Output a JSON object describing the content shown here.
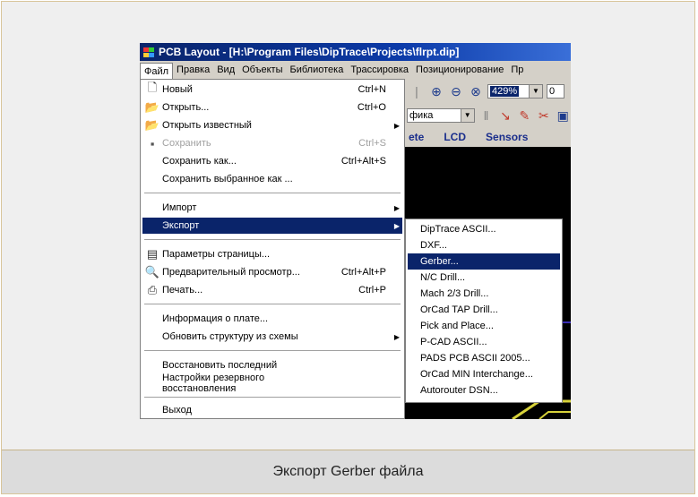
{
  "caption": "Экспорт Gerber файла",
  "window": {
    "title": "PCB Layout - [H:\\Program Files\\DipTrace\\Projects\\flrpt.dip]"
  },
  "menubar": [
    "Файл",
    "Правка",
    "Вид",
    "Объекты",
    "Библиотека",
    "Трассировка",
    "Позиционирование",
    "Пр"
  ],
  "toolbar": {
    "zoom_value": "429%",
    "combo2_value": "фика",
    "trailing_value": "0"
  },
  "tabs": [
    "ete",
    "LCD",
    "Sensors"
  ],
  "file_menu": {
    "items": [
      {
        "icon": "new-doc-icon",
        "label": "Новый",
        "shortcut": "Ctrl+N"
      },
      {
        "icon": "open-folder-icon",
        "label": "Открыть...",
        "shortcut": "Ctrl+O"
      },
      {
        "icon": "open-folder-icon",
        "label": "Открыть известный",
        "submenu": true
      },
      {
        "icon": "save-icon",
        "label": "Сохранить",
        "shortcut": "Ctrl+S",
        "disabled": true
      },
      {
        "label": "Сохранить как...",
        "shortcut": "Ctrl+Alt+S"
      },
      {
        "label": "Сохранить выбранное как ..."
      },
      {
        "label": "Импорт",
        "submenu": true
      },
      {
        "label": "Экспорт",
        "submenu": true,
        "highlighted": true
      },
      {
        "icon": "page-setup-icon",
        "label": "Параметры страницы..."
      },
      {
        "icon": "preview-icon",
        "label": "Предварительный просмотр...",
        "shortcut": "Ctrl+Alt+P"
      },
      {
        "icon": "printer-icon",
        "label": "Печать...",
        "shortcut": "Ctrl+P"
      },
      {
        "label": "Информация о плате..."
      },
      {
        "label": "Обновить структуру из схемы",
        "submenu": true
      },
      {
        "label": "Восстановить последний"
      },
      {
        "label": "Настройки резервного восстановления"
      },
      {
        "label": "Выход"
      }
    ]
  },
  "export_submenu": {
    "items": [
      {
        "label": "DipTrace ASCII..."
      },
      {
        "label": "DXF..."
      },
      {
        "label": "Gerber...",
        "highlighted": true
      },
      {
        "label": "N/C Drill..."
      },
      {
        "label": "Mach 2/3 Drill..."
      },
      {
        "label": "OrCad TAP Drill..."
      },
      {
        "label": "Pick and Place..."
      },
      {
        "label": "P-CAD ASCII..."
      },
      {
        "label": "PADS PCB ASCII 2005..."
      },
      {
        "label": "OrCad MIN Interchange..."
      },
      {
        "label": "Autorouter DSN..."
      }
    ]
  },
  "colors": {
    "highlight": "#0a246a",
    "menu_bg": "#ffffff",
    "chrome": "#d4d0c8",
    "title_bar": "#0a246a"
  }
}
